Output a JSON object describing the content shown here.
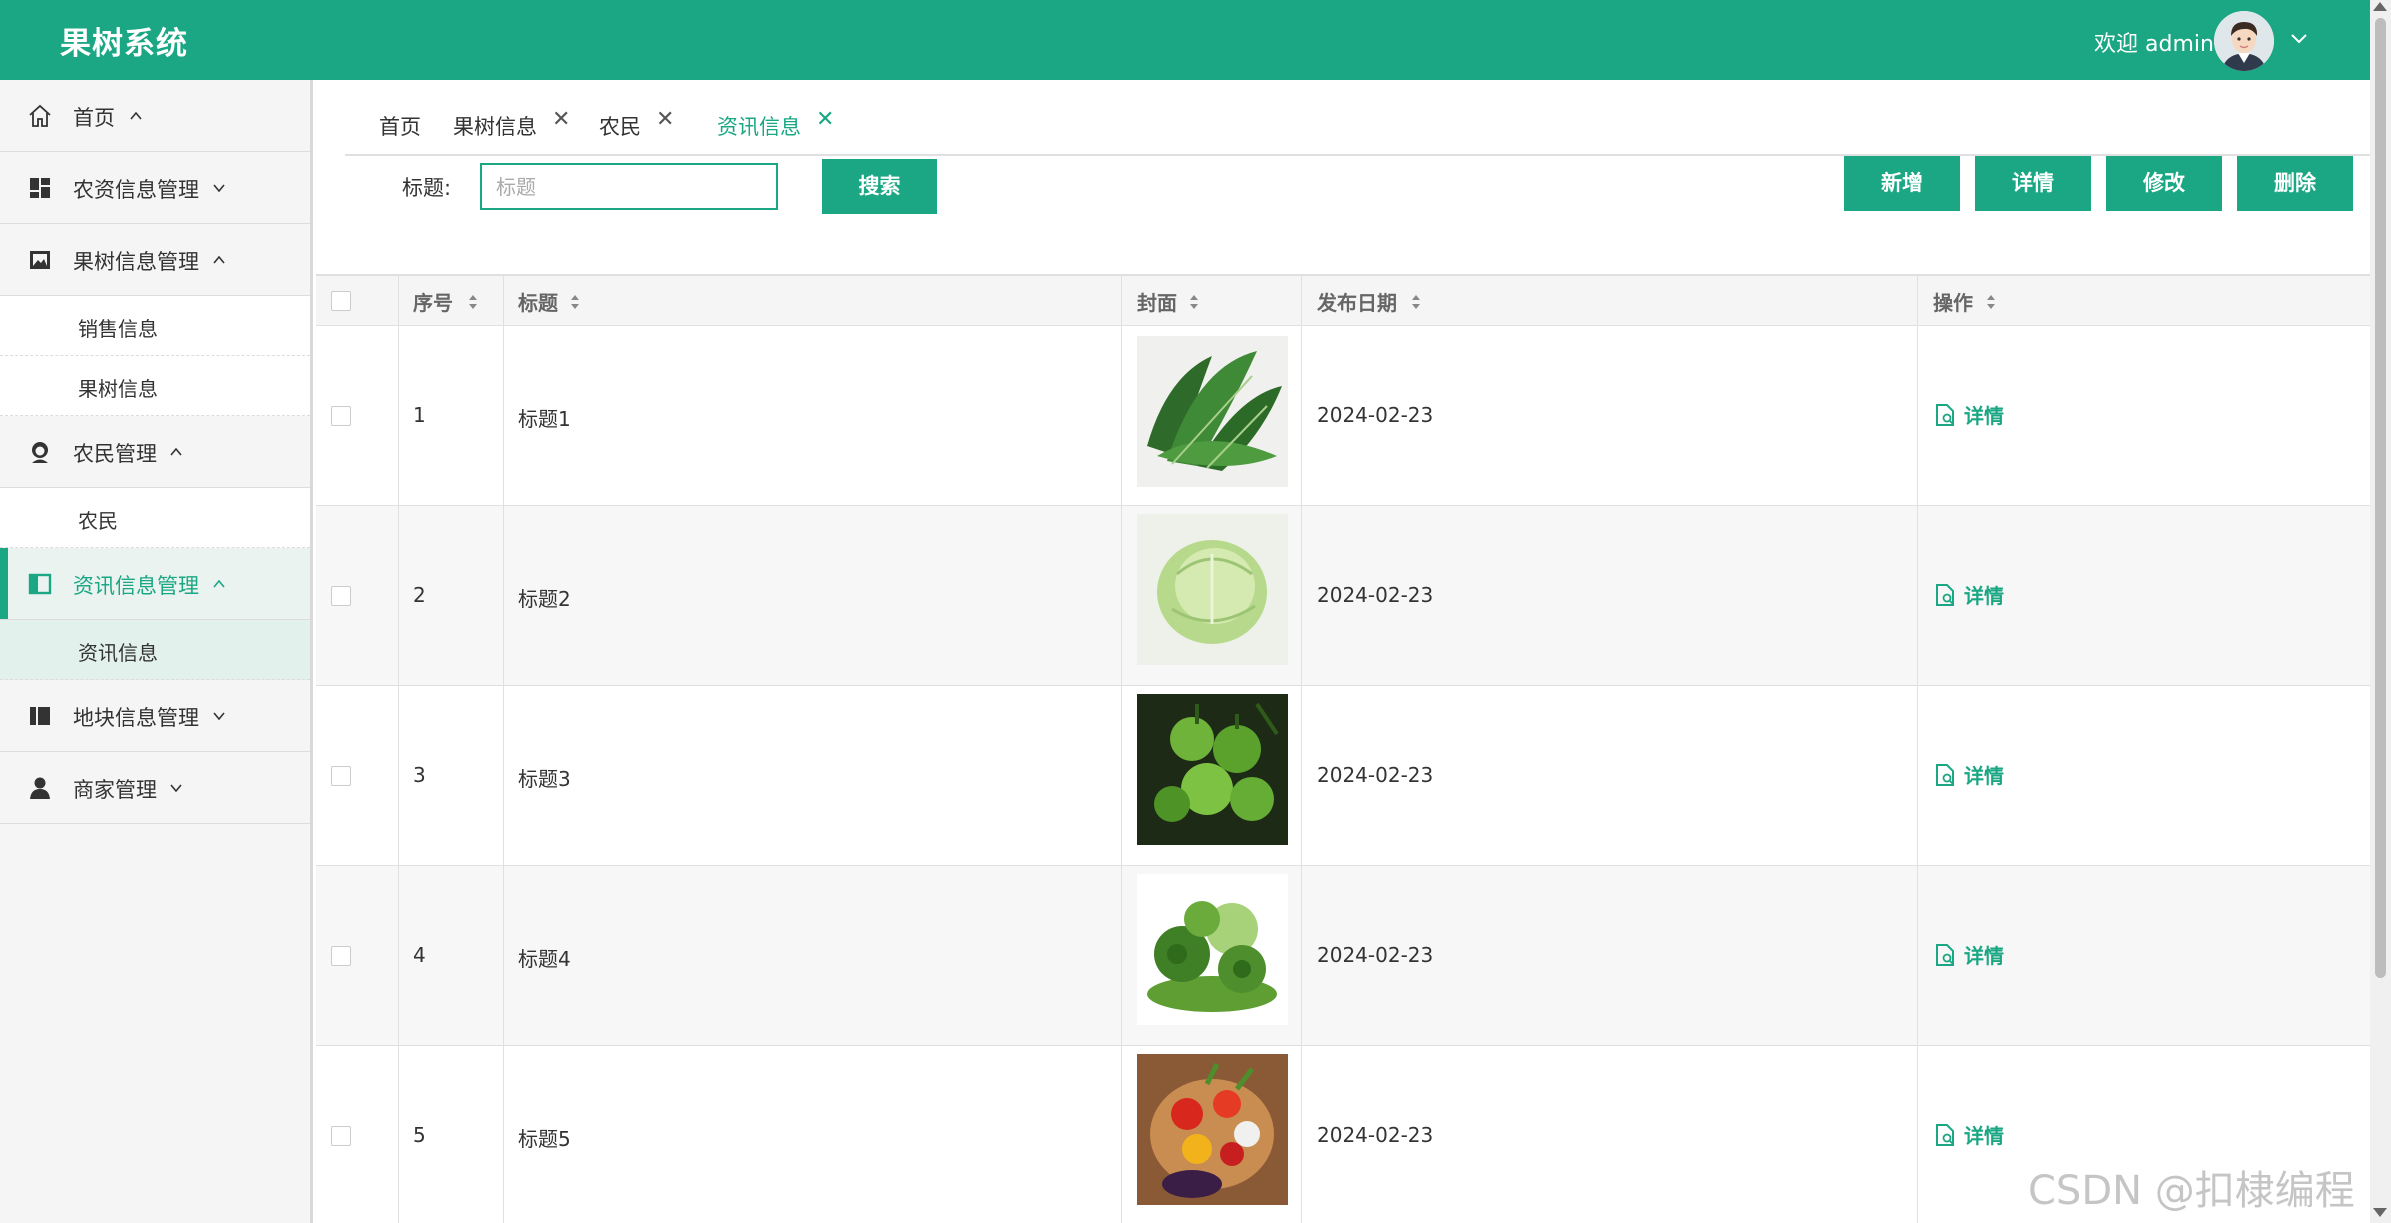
{
  "colors": {
    "accent": "#1ba784",
    "sidebar_bg": "#f5f5f5",
    "row_alt": "#f7f7f7"
  },
  "header": {
    "title": "果树系统",
    "welcome": "欢迎 admin"
  },
  "sidebar": {
    "items": [
      {
        "label": "首页",
        "icon": "home-icon",
        "expanded": true
      },
      {
        "label": "农资信息管理",
        "icon": "dashboard-icon",
        "expanded": false
      },
      {
        "label": "果树信息管理",
        "icon": "image-frame-icon",
        "expanded": true,
        "children": [
          "销售信息",
          "果树信息"
        ]
      },
      {
        "label": "农民管理",
        "icon": "farmer-icon",
        "expanded": true,
        "children": [
          "农民"
        ]
      },
      {
        "label": "资讯信息管理",
        "icon": "panel-icon",
        "expanded": true,
        "active": true,
        "children": [
          "资讯信息"
        ]
      },
      {
        "label": "地块信息管理",
        "icon": "column-icon",
        "expanded": false
      },
      {
        "label": "商家管理",
        "icon": "user-icon",
        "expanded": false
      }
    ]
  },
  "tabs": [
    {
      "label": "首页",
      "closable": false
    },
    {
      "label": "果树信息",
      "closable": true
    },
    {
      "label": "农民",
      "closable": true
    },
    {
      "label": "资讯信息",
      "closable": true,
      "active": true
    }
  ],
  "search": {
    "label": "标题:",
    "placeholder": "标题",
    "button": "搜索"
  },
  "toolbar": {
    "add": "新增",
    "detail": "详情",
    "edit": "修改",
    "delete": "删除"
  },
  "table": {
    "columns": [
      "序号",
      "标题",
      "封面",
      "发布日期",
      "操作"
    ],
    "rows": [
      {
        "index": "1",
        "title": "标题1",
        "cover": "leafy-greens",
        "date": "2024-02-23",
        "action": "详情"
      },
      {
        "index": "2",
        "title": "标题2",
        "cover": "cabbage",
        "date": "2024-02-23",
        "action": "详情"
      },
      {
        "index": "3",
        "title": "标题3",
        "cover": "green-tomatoes",
        "date": "2024-02-23",
        "action": "详情"
      },
      {
        "index": "4",
        "title": "标题4",
        "cover": "vegetable-pile",
        "date": "2024-02-23",
        "action": "详情"
      },
      {
        "index": "5",
        "title": "标题5",
        "cover": "vegetable-basket",
        "date": "2024-02-23",
        "action": "详情"
      }
    ]
  },
  "watermark": "CSDN @扣棣编程"
}
